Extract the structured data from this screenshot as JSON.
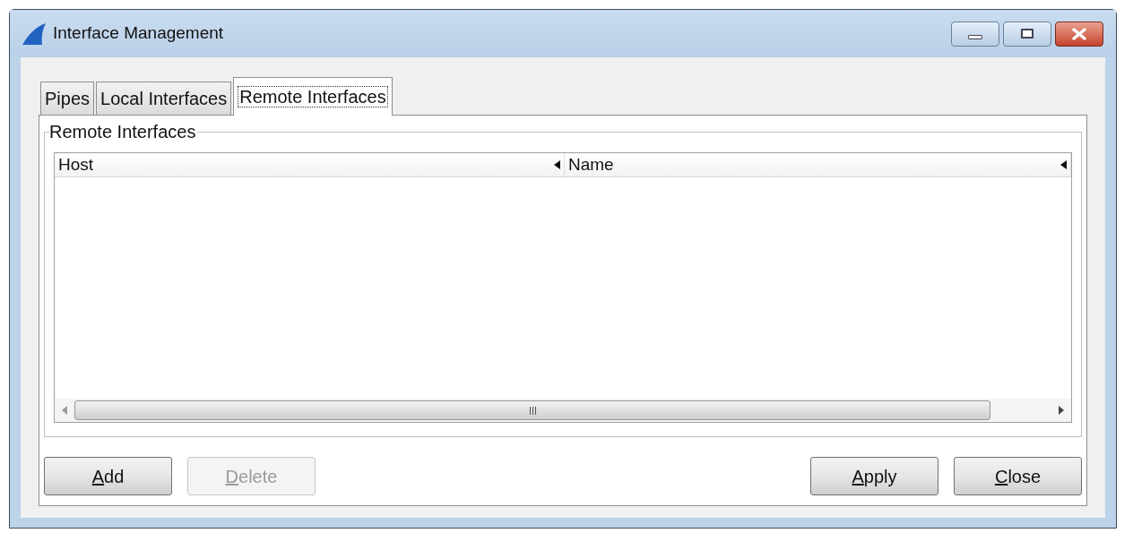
{
  "window": {
    "title": "Interface Management"
  },
  "tabs": [
    {
      "label": "Pipes",
      "selected": false
    },
    {
      "label": "Local Interfaces",
      "selected": false
    },
    {
      "label": "Remote Interfaces",
      "selected": true
    }
  ],
  "group": {
    "title": "Remote Interfaces"
  },
  "table": {
    "columns": [
      "Host",
      "Name"
    ]
  },
  "left_buttons": [
    {
      "label": "Add",
      "disabled": false,
      "mnemonic": true
    },
    {
      "label": "Delete",
      "disabled": true,
      "mnemonic": true
    }
  ],
  "right_buttons": [
    {
      "label": "Apply",
      "disabled": false,
      "mnemonic": true
    },
    {
      "label": "Close",
      "disabled": false,
      "mnemonic": true
    }
  ]
}
